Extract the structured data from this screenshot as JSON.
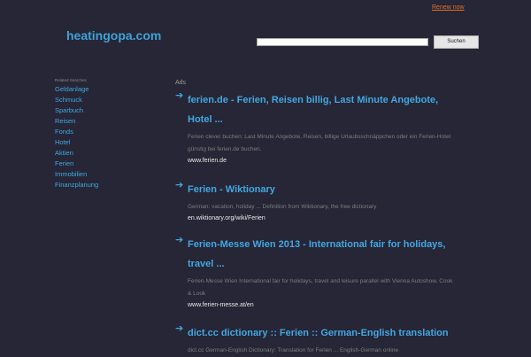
{
  "header": {
    "renew_link": "Renew now",
    "domain": "heatingopa.com",
    "search_value": "",
    "search_button": "Suchen"
  },
  "sidebar": {
    "title": "Related Searches",
    "items": [
      "Geldanlage",
      "Schmuck",
      "Sparbuch",
      "Reisen",
      "Fonds",
      "Hotel",
      "Aktien",
      "Ferien",
      "Immobilien",
      "Finanzplanung"
    ]
  },
  "ads": {
    "label": "Ads",
    "items": [
      {
        "title": "ferien.de - Ferien, Reisen billig, Last Minute Angebote, Hotel ...",
        "desc": "Ferien clever buchen: Last Minute Angebote, Reisen, billige Urlaubsschnäppchen oder ein Ferien-Hotel günstig bei ferien.de buchen.",
        "url": "www.ferien.de"
      },
      {
        "title": "Ferien - Wiktionary",
        "desc": "German: vacation, holiday ... Definition from Wiktionary, the free dictionary",
        "url": "en.wiktionary.org/wiki/Ferien"
      },
      {
        "title": "Ferien-Messe Wien 2013 - International fair for holidays, travel ...",
        "desc": "Ferien-Messe Wien International fair for holidays, travel and leisure parallel with Vienna Autoshow, Cook & Look",
        "url": "www.ferien-messe.at/en"
      },
      {
        "title": "dict.cc dictionary :: Ferien :: German-English translation",
        "desc": "dict.cc German-English Dictionary: Translation for Ferien ... English-German online",
        "url": ""
      }
    ]
  },
  "colors": {
    "background": "#262636",
    "link": "#43a6e0",
    "logo": "#3ea2d8",
    "renew": "#e0702a"
  },
  "icons": {
    "ad_arrow": "arrow-right-icon"
  }
}
